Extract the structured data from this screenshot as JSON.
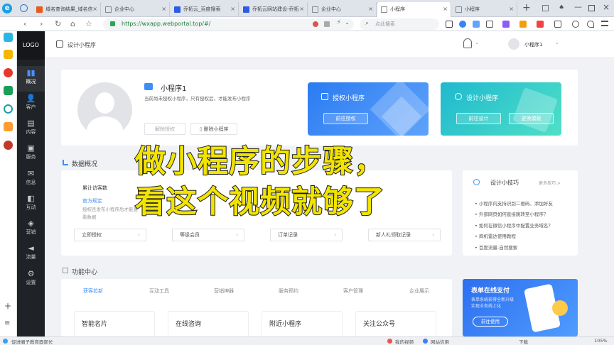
{
  "browser": {
    "tabs": [
      "域名查询结果_域名信",
      "企业中心",
      "乔拓云_百度搜索",
      "乔拓云网站建设-乔拓",
      "企业中心",
      "小程序",
      "小程序"
    ],
    "url": "https://wxapp.webportal.top/#/",
    "search_placeholder": "点此搜索"
  },
  "sidebar": {
    "logo": "LOGO",
    "items": [
      {
        "label": "概况",
        "icon": "bar-chart-icon"
      },
      {
        "label": "客户",
        "icon": "user-icon"
      },
      {
        "label": "内容",
        "icon": "document-icon"
      },
      {
        "label": "服务",
        "icon": "service-icon"
      },
      {
        "label": "信息",
        "icon": "message-icon"
      },
      {
        "label": "互动",
        "icon": "chat-icon"
      },
      {
        "label": "营销",
        "icon": "tag-icon"
      },
      {
        "label": "流量",
        "icon": "megaphone-icon"
      },
      {
        "label": "设置",
        "icon": "gear-icon"
      }
    ]
  },
  "header": {
    "breadcrumb": "设计小程序",
    "user": "小程序1"
  },
  "profile": {
    "name": "小程序1",
    "desc": "当前尚未授权小程序，只有授权后，才能发布小程序",
    "btn_unbind": "解除授权",
    "btn_delete": "删除小程序"
  },
  "promo": {
    "auth": {
      "title": "授权小程序",
      "button": "前往授权"
    },
    "design": {
      "title": "设计小程序",
      "button1": "前往设计",
      "button2": "更换模板"
    }
  },
  "overview": {
    "title": "数据概况",
    "visits_label": "累计访客数",
    "link_text": "官方规定",
    "note": "授权且发布小程序后才能查看数据",
    "actions": [
      "立即授权",
      "等级会员",
      "订单记录",
      "新人礼领取记录"
    ]
  },
  "tips": {
    "title": "设计小技巧",
    "more": "更多技巧 >",
    "items": [
      "小程序内支持识别二维码、添加好友",
      "外部网页如何直接跳转至小程序？",
      "如何在微信小程序中配置业务域名？",
      "商机雷达使用教程",
      "百度流量-自然搜索"
    ]
  },
  "functions": {
    "title": "功能中心",
    "tabs": [
      "获客拉新",
      "互动工具",
      "营销神器",
      "服务预约",
      "客户管理",
      "企业展示"
    ],
    "cards": [
      "智能名片",
      "在线咨询",
      "附近小程序",
      "关注公众号"
    ]
  },
  "promo_banner": {
    "title": "表单在线支付",
    "sub1": "表单系统获得全新升级",
    "sub2": "实现业务线上化",
    "button": "前往使用"
  },
  "statusbar": {
    "left": "促进圈子教育面部长",
    "items": [
      "我的视频",
      "网站信用",
      "下载",
      "105%"
    ]
  },
  "overlay": {
    "line1": "做小程序的步骤，",
    "line2": "看这个视频就够了"
  },
  "colors": {
    "accent": "#3e8ef7",
    "teal": "#35c8c8",
    "overlay_text": "#f2e400",
    "sidebar": "#1f2227"
  }
}
